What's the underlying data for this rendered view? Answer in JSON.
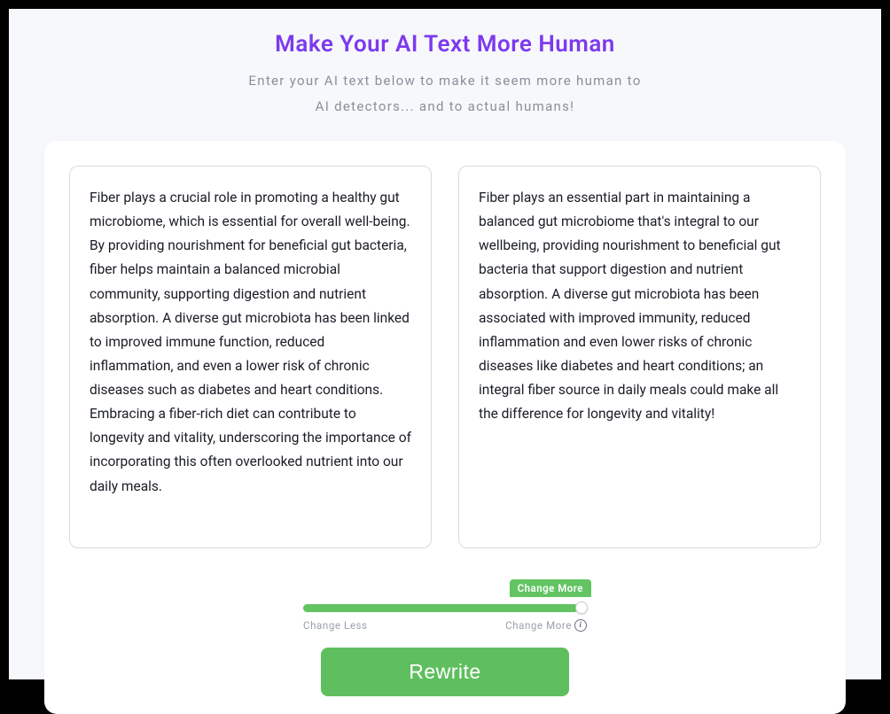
{
  "header": {
    "title": "Make Your AI Text More Human",
    "subtitle_line1": "Enter your AI text below to make it seem more human to",
    "subtitle_line2": "AI detectors... and to actual humans!"
  },
  "panels": {
    "input_text": "Fiber plays a crucial role in promoting a healthy gut microbiome, which is essential for overall well-being. By providing nourishment for beneficial gut bacteria, fiber helps maintain a balanced microbial community, supporting digestion and nutrient absorption. A diverse gut microbiota has been linked to improved immune function, reduced inflammation, and even a lower risk of chronic diseases such as diabetes and heart conditions. Embracing a fiber-rich diet can contribute to longevity and vitality, underscoring the importance of incorporating this often overlooked nutrient into our daily meals.",
    "output_text": "Fiber plays an essential part in maintaining a balanced gut microbiome that's integral to our wellbeing, providing nourishment to beneficial gut bacteria that support digestion and nutrient absorption. A diverse gut microbiota has been associated with improved immunity, reduced inflammation and even lower risks of chronic diseases like diabetes and heart conditions; an integral fiber source in daily meals could make all the difference for longevity and vitality!"
  },
  "slider": {
    "badge_label": "Change More",
    "left_label": "Change Less",
    "right_label": "Change More",
    "value_percent": 97
  },
  "buttons": {
    "rewrite": "Rewrite"
  },
  "colors": {
    "accent_purple": "#7c3aed",
    "accent_green": "#5fbf5f"
  }
}
